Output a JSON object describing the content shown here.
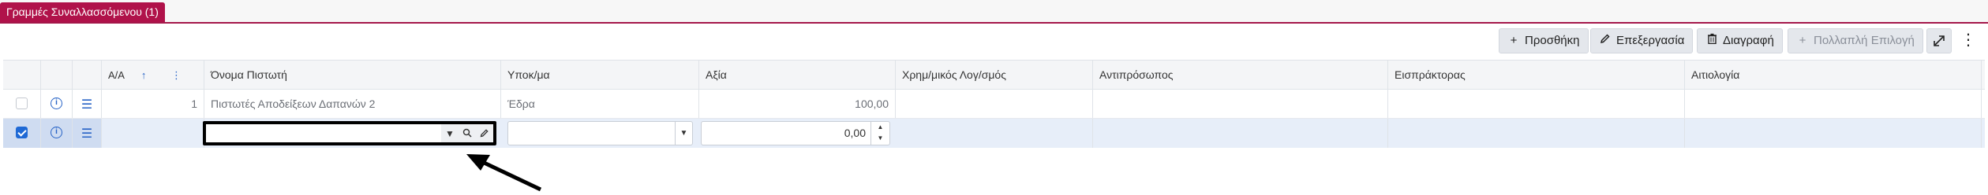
{
  "tab": {
    "label": "Γραμμές Συναλλασσόμενου (1)"
  },
  "toolbar": {
    "add_label": "Προσθήκη",
    "edit_label": "Επεξεργασία",
    "delete_label": "Διαγραφή",
    "multi_label": "Πολλαπλή Επιλογή"
  },
  "grid": {
    "columns": {
      "aa": "Α/Α",
      "creditor_name": "Όνομα Πιστωτή",
      "branch": "Υποκ/μα",
      "value": "Αξία",
      "account": "Χρημ/μικός Λογ/σμός",
      "representative": "Αντιπρόσωπος",
      "collector": "Εισπράκτορας",
      "reason": "Αιτιολογία"
    },
    "rows": [
      {
        "aa": "1",
        "creditor_name": "Πιστωτές Αποδείξεων Δαπανών 2",
        "branch": "Έδρα",
        "value": "100,00",
        "account": "",
        "representative": "",
        "collector": "",
        "reason": ""
      }
    ],
    "edit_row": {
      "creditor_name": "",
      "branch": "",
      "value": "0,00"
    }
  },
  "colors": {
    "tab_bg": "#b0124a",
    "accent": "#2763c6",
    "selected_row": "#e7eef9"
  }
}
